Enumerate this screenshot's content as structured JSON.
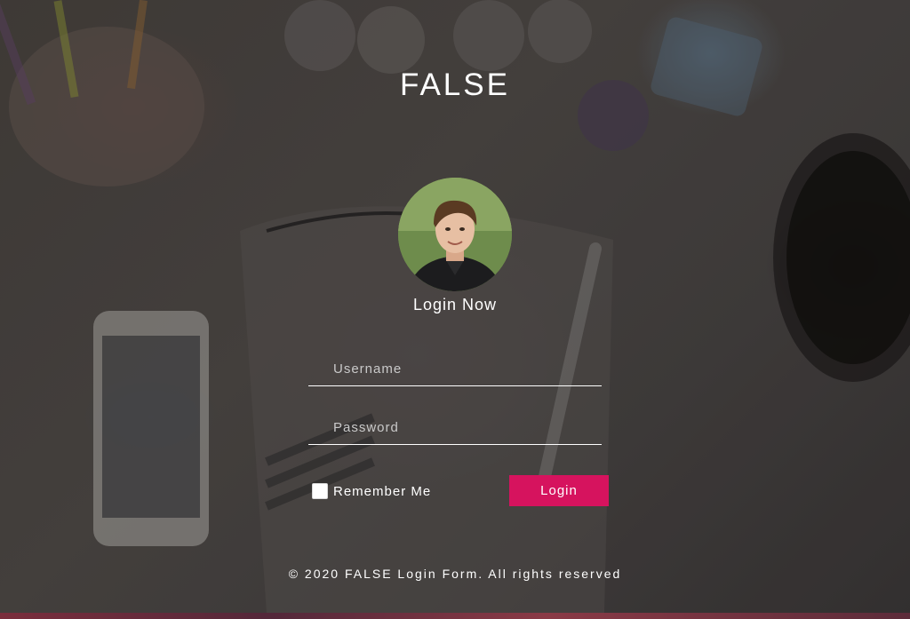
{
  "app": {
    "title": "FALSE"
  },
  "login": {
    "heading": "Login Now",
    "username_placeholder": "Username",
    "password_placeholder": "Password",
    "remember_label": "Remember Me",
    "remember_checked": false,
    "submit_label": "Login"
  },
  "footer": {
    "text": "© 2020 FALSE Login Form. All rights reserved"
  },
  "colors": {
    "accent": "#d6135e",
    "text": "#ffffff",
    "background": "#4c4642"
  },
  "icons": {
    "avatar": "user-avatar"
  }
}
